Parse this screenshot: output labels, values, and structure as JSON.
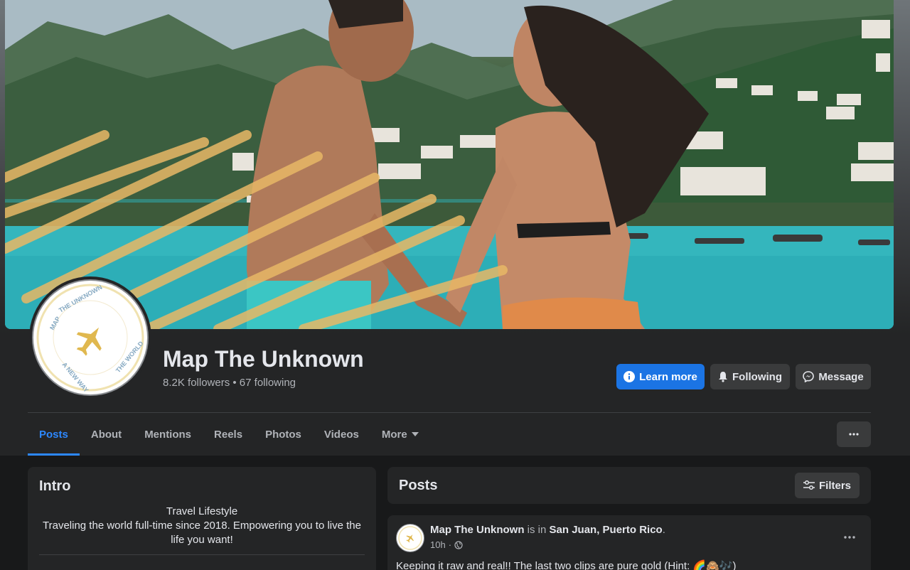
{
  "page": {
    "name": "Map The Unknown",
    "stats": "8.2K followers • 67 following",
    "cover_alt": "Couple holding hands by turquoise bay",
    "avatar_ring_text": "MAP THE UNKNOWN · A NEW WAY TO SEE THE WORLD"
  },
  "actions": {
    "learn_more": "Learn more",
    "following": "Following",
    "message": "Message"
  },
  "tabs": [
    {
      "label": "Posts",
      "active": true
    },
    {
      "label": "About"
    },
    {
      "label": "Mentions"
    },
    {
      "label": "Reels"
    },
    {
      "label": "Photos"
    },
    {
      "label": "Videos"
    },
    {
      "label": "More"
    }
  ],
  "intro": {
    "title": "Intro",
    "line1": "Travel Lifestyle",
    "line2": "Traveling the world full-time since 2018. Empowering you to live the life you want!"
  },
  "posts": {
    "title": "Posts",
    "filters_label": "Filters"
  },
  "post": {
    "author": "Map The Unknown",
    "is_in": " is in ",
    "location": "San Juan, Puerto Rico",
    "period": ".",
    "time": "10h",
    "dot": "·",
    "text": "Keeping it raw and real!! The last two clips are pure gold (Hint: 🌈🙈🎶)"
  },
  "colors": {
    "primary": "#1b74e4",
    "active_tab": "#2d88ff",
    "card_bg": "#242526",
    "page_bg": "#18191a"
  },
  "icons": {
    "learn_more": "info-icon",
    "following": "bell-icon",
    "message": "messenger-icon",
    "more": "caret-down-icon",
    "overflow": "ellipsis-icon",
    "filters": "sliders-icon",
    "audience": "globe-icon",
    "avatar_logo": "airplane-icon"
  }
}
